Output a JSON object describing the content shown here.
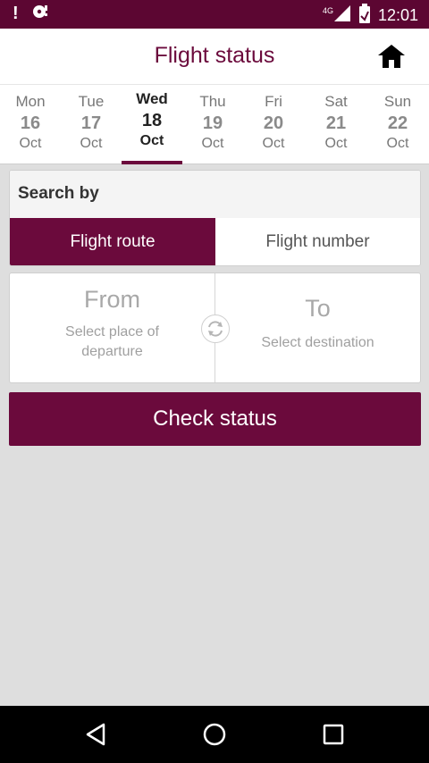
{
  "status_bar": {
    "time": "12:01",
    "network": "4G",
    "left_icons": [
      "alert-icon",
      "sync-disk-icon"
    ],
    "right_icons": [
      "signal-icon",
      "battery-icon"
    ]
  },
  "header": {
    "title": "Flight status",
    "home_icon": "home-icon"
  },
  "dates": [
    {
      "dow": "Mon",
      "day": "16",
      "month": "Oct",
      "active": false
    },
    {
      "dow": "Tue",
      "day": "17",
      "month": "Oct",
      "active": false
    },
    {
      "dow": "Wed",
      "day": "18",
      "month": "Oct",
      "active": true
    },
    {
      "dow": "Thu",
      "day": "19",
      "month": "Oct",
      "active": false
    },
    {
      "dow": "Fri",
      "day": "20",
      "month": "Oct",
      "active": false
    },
    {
      "dow": "Sat",
      "day": "21",
      "month": "Oct",
      "active": false
    },
    {
      "dow": "Sun",
      "day": "22",
      "month": "Oct",
      "active": false
    }
  ],
  "search": {
    "label": "Search by",
    "tabs": [
      {
        "label": "Flight route",
        "selected": true
      },
      {
        "label": "Flight number",
        "selected": false
      }
    ]
  },
  "route": {
    "from_label": "From",
    "from_hint": "Select place of departure",
    "to_label": "To",
    "to_hint": "Select destination",
    "swap_icon": "swap-icon"
  },
  "actions": {
    "check_status_label": "Check status"
  },
  "nav": [
    "back-icon",
    "home-circle-icon",
    "recents-icon"
  ],
  "colors": {
    "brand": "#6b0a3c",
    "status_bar": "#5c0632",
    "background": "#dedede"
  }
}
